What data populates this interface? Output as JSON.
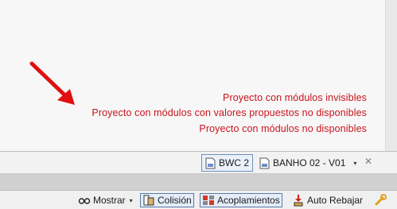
{
  "notes": [
    "Proyecto con módulos invisibles",
    "Proyecto con módulos con valores propuestos no disponibles",
    "Proyecto con módulos no disponibles"
  ],
  "colors": {
    "note_red": "#c8141e",
    "arrow_red": "#e01010",
    "accent_blue": "#5a7aa8"
  },
  "doc_tabs": {
    "active": {
      "label": "BWC 2",
      "icon": "document-icon"
    },
    "current": {
      "label": "BANHO 02 - V01",
      "icon": "document-icon"
    },
    "dropdown": "▾",
    "close": "✕"
  },
  "status_bar": {
    "mostrar": {
      "label": "Mostrar",
      "icon": "glasses-icon",
      "caret": "▾"
    },
    "colision": {
      "label": "Colisión",
      "icon": "collision-icon"
    },
    "acoplamientos": {
      "label": "Acoplamientos",
      "icon": "coupling-icon"
    },
    "auto_rebajar": {
      "label": "Auto Rebajar",
      "icon": "auto-lower-icon"
    },
    "tools": {
      "icon": "wrench-icon"
    }
  }
}
